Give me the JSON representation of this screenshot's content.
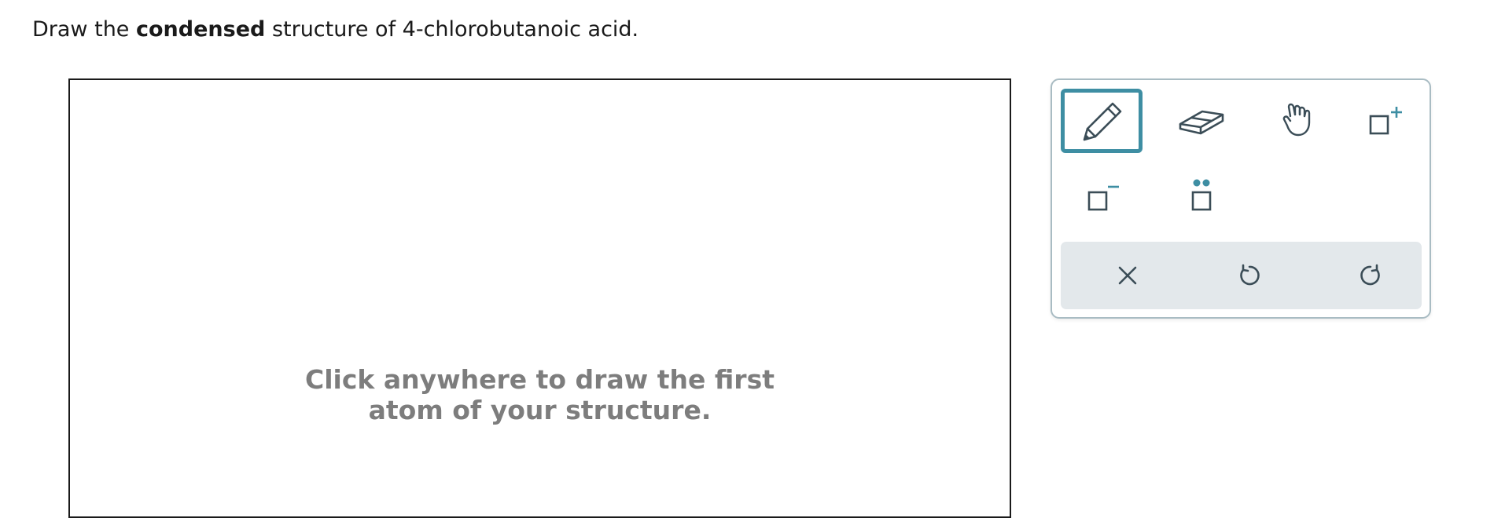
{
  "question": {
    "prefix": "Draw the ",
    "emphasis": "condensed",
    "suffix": " structure of 4-chlorobutanoic acid."
  },
  "canvas": {
    "hint_line1": "Click anywhere to draw the first",
    "hint_line2": "atom of your structure."
  },
  "toolbox": {
    "tools": [
      {
        "name": "pencil-tool",
        "icon": "pencil-icon",
        "selected": true
      },
      {
        "name": "eraser-tool",
        "icon": "eraser-icon",
        "selected": false
      },
      {
        "name": "hand-tool",
        "icon": "hand-icon",
        "selected": false
      },
      {
        "name": "positive-charge-tool",
        "icon": "positive-charge-icon",
        "label": "+",
        "selected": false
      },
      {
        "name": "negative-charge-tool",
        "icon": "negative-charge-icon",
        "label": "−",
        "selected": false
      },
      {
        "name": "lone-pair-tool",
        "icon": "lone-pair-icon",
        "selected": false
      }
    ],
    "actions": [
      {
        "name": "clear-button",
        "icon": "close-icon"
      },
      {
        "name": "undo-button",
        "icon": "undo-icon"
      },
      {
        "name": "redo-button",
        "icon": "redo-icon"
      }
    ]
  },
  "colors": {
    "accent": "#3e8ea3",
    "icon": "#3b4d57",
    "hint": "#7d7d7d",
    "action_bar": "#e3e8eb",
    "toolbox_border": "#a9bcc3"
  }
}
